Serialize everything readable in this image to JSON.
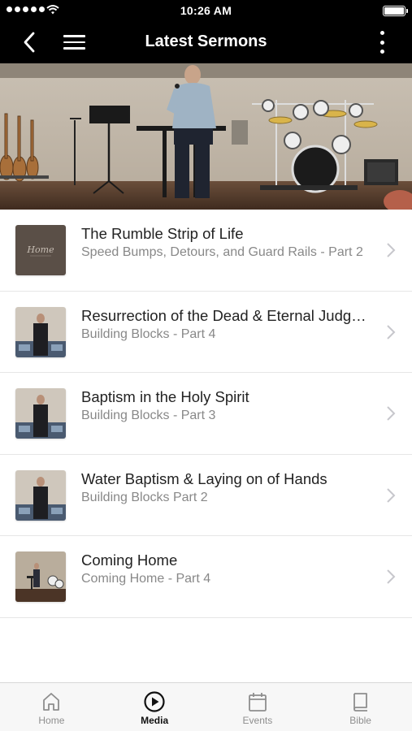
{
  "status_bar": {
    "time": "10:26 AM"
  },
  "nav": {
    "title": "Latest Sermons"
  },
  "sermons": [
    {
      "title": "The Rumble Strip of Life",
      "subtitle": "Speed Bumps, Detours, and Guard Rails - Part 2",
      "thumb_text": "Home"
    },
    {
      "title": "Resurrection of the Dead & Eternal Judgment",
      "subtitle": "Building Blocks - Part 4"
    },
    {
      "title": "Baptism in the Holy Spirit",
      "subtitle": "Building Blocks - Part 3"
    },
    {
      "title": "Water Baptism & Laying on of Hands",
      "subtitle": "Building Blocks Part 2"
    },
    {
      "title": "Coming Home",
      "subtitle": "Coming Home - Part 4"
    }
  ],
  "tabs": [
    {
      "label": "Home",
      "icon": "home-icon",
      "active": false
    },
    {
      "label": "Media",
      "icon": "play-circle-icon",
      "active": true
    },
    {
      "label": "Events",
      "icon": "calendar-icon",
      "active": false
    },
    {
      "label": "Bible",
      "icon": "book-icon",
      "active": false
    }
  ],
  "colors": {
    "header_bg": "#000000",
    "subtitle": "#888888",
    "tab_active": "#111111",
    "tab_inactive": "#8e8e8e"
  }
}
